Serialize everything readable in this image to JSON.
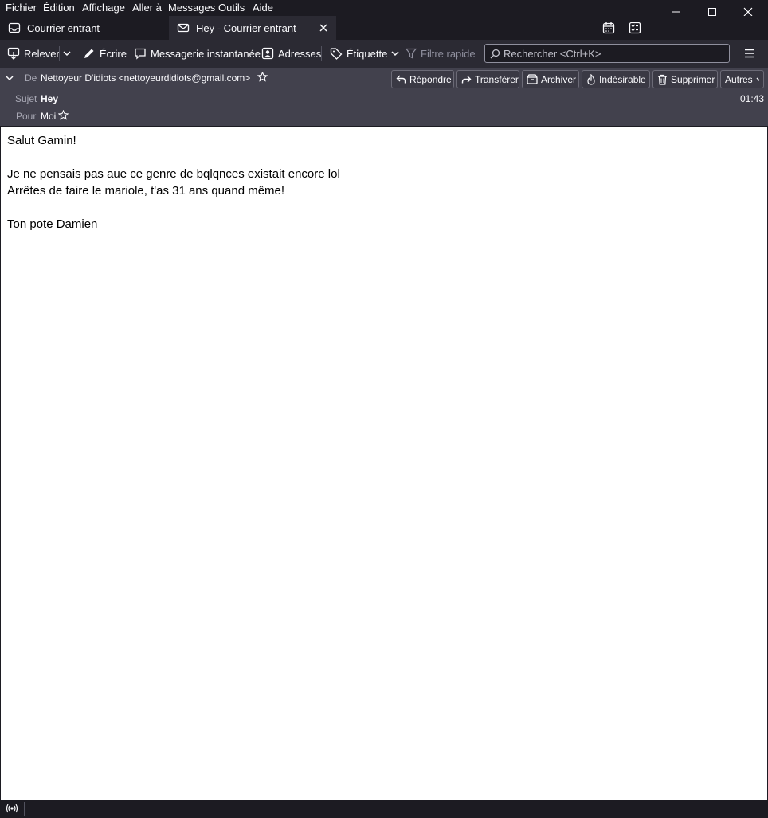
{
  "menubar": {
    "items": [
      "Fichier",
      "Édition",
      "Affichage",
      "Aller à",
      "Messages",
      "Outils",
      "Aide"
    ]
  },
  "tabs": [
    {
      "label": "Courrier entrant",
      "icon": "inbox-icon"
    },
    {
      "label": "Hey - Courrier entrant",
      "icon": "envelope-icon"
    }
  ],
  "toolbar": {
    "get_mail": "Relever",
    "write": "Écrire",
    "chat": "Messagerie instantanée",
    "address_book": "Adresses",
    "tag": "Étiquette",
    "quick_filter": "Filtre rapide",
    "search_placeholder": "Rechercher <Ctrl+K>"
  },
  "header": {
    "from_label": "De",
    "from_value": "Nettoyeur D'idiots <nettoyeurdidiots@gmail.com>",
    "subject_label": "Sujet",
    "subject_value": "Hey",
    "to_label": "Pour",
    "to_value": "Moi",
    "time": "01:43",
    "actions": {
      "reply": "Répondre",
      "forward": "Transférer",
      "archive": "Archiver",
      "junk": "Indésirable",
      "delete": "Supprimer",
      "more": "Autres"
    }
  },
  "message": {
    "lines": [
      "Salut Gamin!",
      "",
      "Je ne pensais pas aue ce genre de bqlqnces existait encore lol",
      "Arrêtes de faire le mariole, t'as 31 ans quand même!",
      "",
      "Ton pote Damien"
    ]
  },
  "colors": {
    "chrome_dark": "#1c1b22",
    "toolbar": "#2b2a33",
    "header_pane": "#42414d",
    "body_bg": "#ffffff"
  }
}
